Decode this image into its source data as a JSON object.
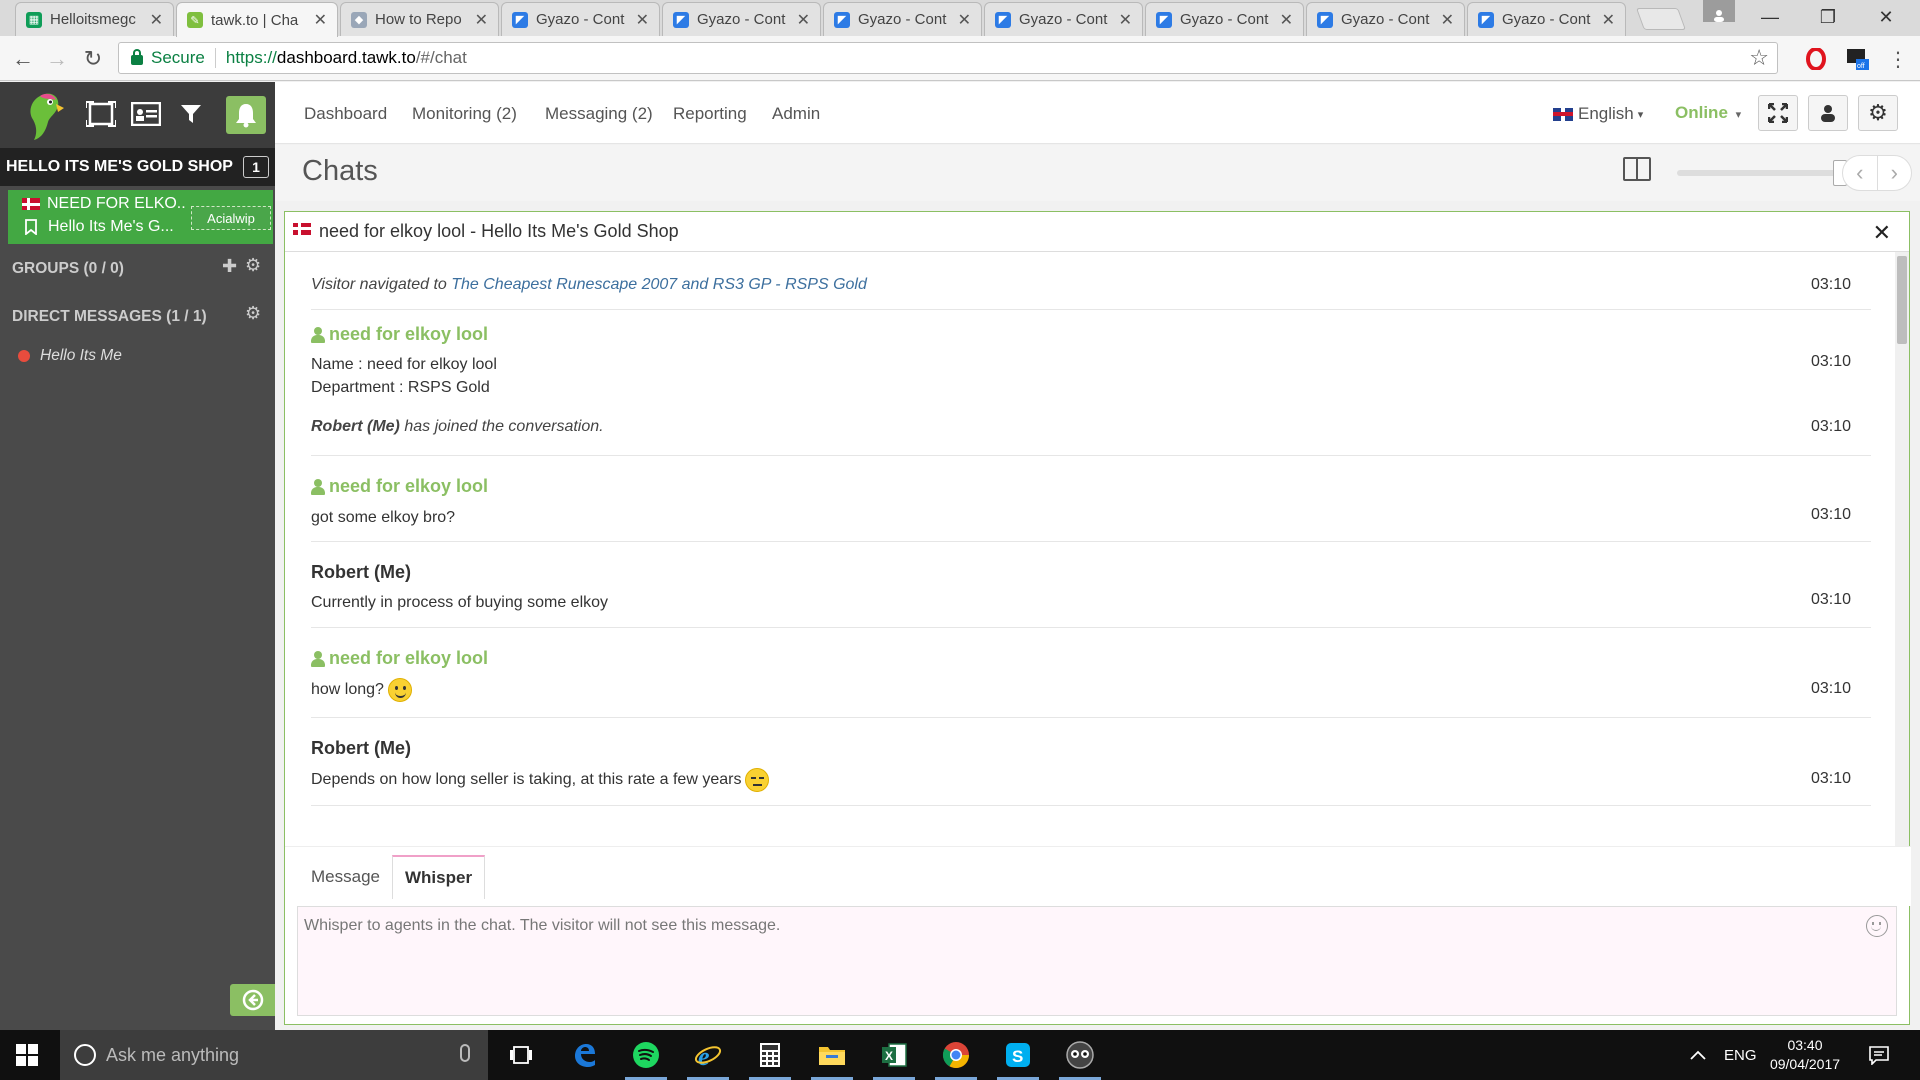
{
  "browser": {
    "tabs": [
      {
        "label": "Helloitsmegc",
        "icon": "sheets-icon",
        "active": false
      },
      {
        "label": "tawk.to | Cha",
        "icon": "tawk-icon",
        "active": true
      },
      {
        "label": "How to Repo",
        "icon": "shield-icon",
        "active": false
      },
      {
        "label": "Gyazo - Cont",
        "icon": "gyazo-icon",
        "active": false
      },
      {
        "label": "Gyazo - Cont",
        "icon": "gyazo-icon",
        "active": false
      },
      {
        "label": "Gyazo - Cont",
        "icon": "gyazo-icon",
        "active": false
      },
      {
        "label": "Gyazo - Cont",
        "icon": "gyazo-icon",
        "active": false
      },
      {
        "label": "Gyazo - Cont",
        "icon": "gyazo-icon",
        "active": false
      },
      {
        "label": "Gyazo - Cont",
        "icon": "gyazo-icon",
        "active": false
      },
      {
        "label": "Gyazo - Cont",
        "icon": "gyazo-icon",
        "active": false
      }
    ],
    "secure_label": "Secure",
    "url_scheme": "https://",
    "url_host": "dashboard.tawk.to",
    "url_path": "/#/chat"
  },
  "sidebar": {
    "shop_name": "HELLO ITS ME'S GOLD SHOP",
    "shop_count": "1",
    "active_chat": {
      "visitor": "NEED FOR ELKO..",
      "site": "Hello Its Me's G...",
      "tag": "Acialwip"
    },
    "groups_label": "GROUPS (0 / 0)",
    "direct_messages_label": "DIRECT MESSAGES (1 / 1)",
    "dm_user": "Hello Its Me"
  },
  "topnav": {
    "links": [
      "Dashboard",
      "Monitoring (2)",
      "Messaging (2)",
      "Reporting",
      "Admin"
    ],
    "language": "English",
    "status": "Online"
  },
  "chats": {
    "title": "Chats",
    "chat_title": "need for elkoy lool - Hello Its Me's Gold Shop",
    "messages": [
      {
        "type": "nav",
        "prefix": "Visitor navigated to ",
        "link": "The Cheapest Runescape 2007 and RS3 GP - RSPS Gold",
        "time": "03:10"
      },
      {
        "type": "visitor-info",
        "sender": "need for elkoy lool",
        "line1": "Name : need for elkoy lool",
        "line2": "Department : RSPS Gold",
        "time": "03:10"
      },
      {
        "type": "join",
        "who": "Robert (Me)",
        "text": " has joined the conversation.",
        "time": "03:10"
      },
      {
        "type": "visitor",
        "sender": "need for elkoy lool",
        "text": "got some elkoy bro?",
        "time": "03:10"
      },
      {
        "type": "agent",
        "sender": "Robert (Me)",
        "text": "Currently in process of buying some elkoy",
        "time": "03:10"
      },
      {
        "type": "visitor",
        "sender": "need for elkoy lool",
        "text": "how long?",
        "time": "03:10"
      },
      {
        "type": "agent",
        "sender": "Robert (Me)",
        "text": "Depends on how long seller is taking, at this rate a few years",
        "time": "03:10"
      }
    ],
    "compose_tabs": [
      "Message",
      "Whisper"
    ],
    "compose_placeholder": "Whisper to agents in the chat. The visitor will not see this message."
  },
  "taskbar": {
    "search_placeholder": "Ask me anything",
    "language": "ENG",
    "time": "03:40",
    "date": "09/04/2017"
  },
  "colors": {
    "accent_green": "#8bbf63",
    "active_chat_green": "#43a843",
    "sidebar_bg": "#4a4a4a",
    "link_blue": "#3c6f9e"
  }
}
